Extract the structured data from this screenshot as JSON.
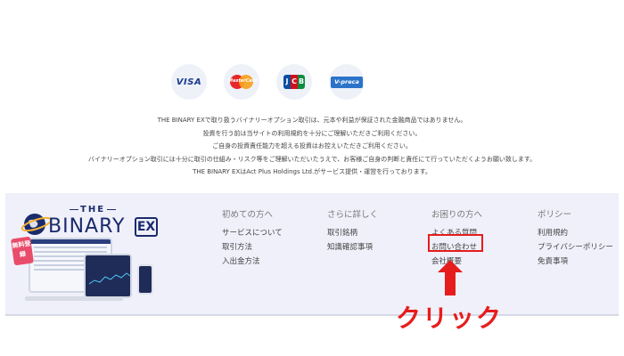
{
  "payments": [
    {
      "name": "VISA",
      "icon": "visa-icon"
    },
    {
      "name": "MasterCard",
      "icon": "mastercard-icon"
    },
    {
      "name": "JCB",
      "icon": "jcb-icon"
    },
    {
      "name": "V-preca",
      "icon": "vpreca-icon"
    }
  ],
  "disclaimer": [
    "THE BINARY EXで取り扱うバイナリーオプション取引は、元本や利益が保証された金融商品ではありません。",
    "投資を行う前は当サイトの利用規約を十分にご理解いただきご利用ください。",
    "ご自身の投資責任能力を超える投資はお控えいただきご利用ください。",
    "バイナリーオプション取引には十分に取引の仕組み・リスク等をご理解いただいたうえで、お客様ご自身の判断と責任にて行っていただくようお願い致します。",
    "THE BINARY EXはAct Plus Holdings Ltd.がサービス提供・運営を行っております。"
  ],
  "logo": {
    "the": "THE",
    "name": "BINARY",
    "ex": "EX"
  },
  "promo": {
    "badge": "無料登録"
  },
  "footer": {
    "columns": [
      {
        "heading": "初めての方へ",
        "links": [
          "サービスについて",
          "取引方法",
          "入出金方法"
        ]
      },
      {
        "heading": "さらに詳しく",
        "links": [
          "取引銘柄",
          "知識確認事項"
        ]
      },
      {
        "heading": "お困りの方へ",
        "links": [
          "よくある質問",
          "お問い合わせ",
          "会社概要"
        ]
      },
      {
        "heading": "ポリシー",
        "links": [
          "利用規約",
          "プライバシーポリシー",
          "免責事項"
        ]
      }
    ]
  },
  "annotation": {
    "click_label": "クリック",
    "highlight_color": "#e61d1d"
  },
  "colors": {
    "footer_bg": "#eff0fa",
    "brand_navy": "#1a2a6c"
  }
}
